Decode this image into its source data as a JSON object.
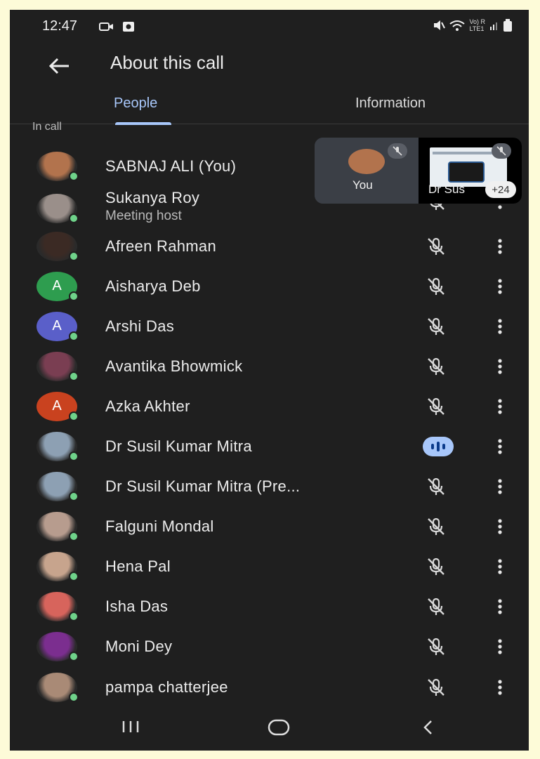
{
  "status_bar": {
    "time": "12:47",
    "network": "Vo) R\nLTE1"
  },
  "header": {
    "title": "About this call"
  },
  "tabs": [
    {
      "label": "People"
    },
    {
      "label": "Information"
    }
  ],
  "section_label": "In call",
  "tiles": {
    "you_label": "You",
    "other_label": "Dr Sus",
    "more_count": "+24"
  },
  "participants": [
    {
      "name": "SABNAJ ALI (You)",
      "avatar": "photo",
      "avatar_color": "#b2734d"
    },
    {
      "name": "Sukanya Roy",
      "subtitle": "Meeting host",
      "avatar": "photo",
      "avatar_color": "#9a8f8a"
    },
    {
      "name": "Afreen Rahman",
      "avatar": "photo",
      "avatar_color": "#3b2a24"
    },
    {
      "name": "Aisharya Deb",
      "avatar": "A",
      "avatar_color": "#2e9d4f"
    },
    {
      "name": "Arshi Das",
      "avatar": "A",
      "avatar_color": "#5a5fc9"
    },
    {
      "name": "Avantika Bhowmick",
      "avatar": "photo",
      "avatar_color": "#7a3e52"
    },
    {
      "name": "Azka Akhter",
      "avatar": "A",
      "avatar_color": "#c9421f"
    },
    {
      "name": "Dr Susil Kumar Mitra",
      "avatar": "photo",
      "avatar_color": "#8da0b3",
      "speaking": true
    },
    {
      "name": "Dr Susil Kumar Mitra (Pre...",
      "avatar": "photo",
      "avatar_color": "#8da0b3"
    },
    {
      "name": "Falguni Mondal",
      "avatar": "photo",
      "avatar_color": "#b79c8e"
    },
    {
      "name": "Hena Pal",
      "avatar": "photo",
      "avatar_color": "#c7a48d"
    },
    {
      "name": "Isha Das",
      "avatar": "photo",
      "avatar_color": "#d7645c"
    },
    {
      "name": "Moni Dey",
      "avatar": "photo",
      "avatar_color": "#7b2e8f"
    },
    {
      "name": "pampa chatterjee",
      "avatar": "photo",
      "avatar_color": "#a98a76"
    }
  ],
  "colors": {
    "background": "#1f1f1f",
    "accent": "#a8c7fa",
    "online": "#6fd28a"
  }
}
